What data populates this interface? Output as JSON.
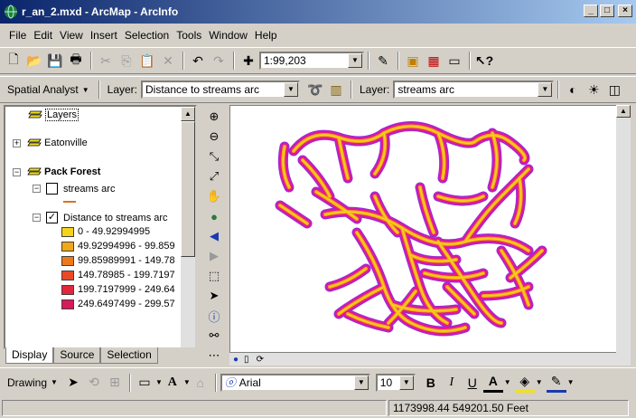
{
  "window": {
    "title": "r_an_2.mxd - ArcMap - ArcInfo",
    "min": "_",
    "max": "□",
    "close": "×"
  },
  "menu": [
    "File",
    "Edit",
    "View",
    "Insert",
    "Selection",
    "Tools",
    "Window",
    "Help"
  ],
  "toolbar": {
    "scale": "1:99,203"
  },
  "spatial_analyst": {
    "label": "Spatial Analyst",
    "layer_label": "Layer:",
    "layer_value": "Distance to streams arc",
    "layer2_label": "Layer:",
    "layer2_value": "streams arc"
  },
  "toc": {
    "layers": "Layers",
    "eatonville": "Eatonville",
    "pack_forest": "Pack Forest",
    "streams_arc": "streams arc",
    "distance": "Distance to streams arc",
    "classes": [
      {
        "label": "0 - 49.92994995",
        "color": "#f5d21c"
      },
      {
        "label": "49.92994996 - 99.859",
        "color": "#f0a818"
      },
      {
        "label": "99.85989991 - 149.78",
        "color": "#ed7a18"
      },
      {
        "label": "149.78985 - 199.7197",
        "color": "#e84a26"
      },
      {
        "label": "199.7197999 - 249.64",
        "color": "#e2283a"
      },
      {
        "label": "249.6497499 - 299.57",
        "color": "#d81a5a"
      }
    ],
    "tabs": [
      "Display",
      "Source",
      "Selection"
    ]
  },
  "drawing": {
    "label": "Drawing",
    "font": "Arial",
    "size": "10",
    "bold": "B",
    "italic": "I",
    "underline": "U",
    "fontcolor": "A"
  },
  "status": {
    "coords": "1173998.44  549201.50 Feet"
  }
}
